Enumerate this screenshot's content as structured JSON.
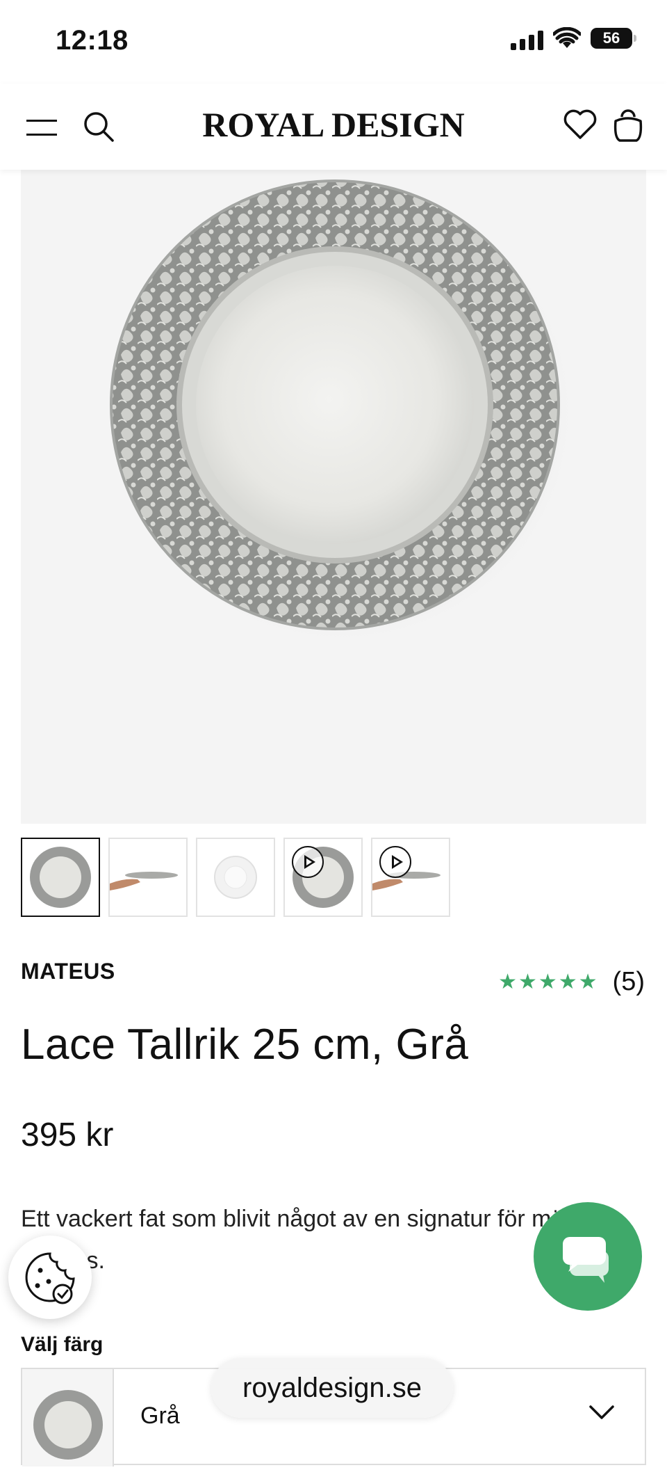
{
  "status_bar": {
    "time": "12:18",
    "battery": "56"
  },
  "header": {
    "logo": "ROYAL DESIGN"
  },
  "product": {
    "brand": "MATEUS",
    "rating_stars": "★★★★★",
    "rating_value": 5,
    "rating_count": "(5)",
    "title": "Lace Tallrik 25 cm, Grå",
    "price": "395 kr",
    "description": "Ett vackert fat som blivit något av en signatur för märket Mateus."
  },
  "thumbnails": [
    {
      "kind": "plate-top",
      "active": true,
      "video": false
    },
    {
      "kind": "plate-hand",
      "active": false,
      "video": false
    },
    {
      "kind": "plate-white",
      "active": false,
      "video": false
    },
    {
      "kind": "plate-top",
      "active": false,
      "video": true
    },
    {
      "kind": "plate-hand",
      "active": false,
      "video": true
    }
  ],
  "color_select": {
    "label": "Välj färg",
    "value": "Grå"
  },
  "browser": {
    "url": "royaldesign.se"
  },
  "colors": {
    "accent_green": "#3fa96a",
    "plate_gray": "#9a9b99"
  },
  "icons": [
    "menu-icon",
    "search-icon",
    "heart-icon",
    "bag-icon",
    "play-icon",
    "cookie-icon",
    "chat-icon",
    "chevron-down-icon"
  ]
}
